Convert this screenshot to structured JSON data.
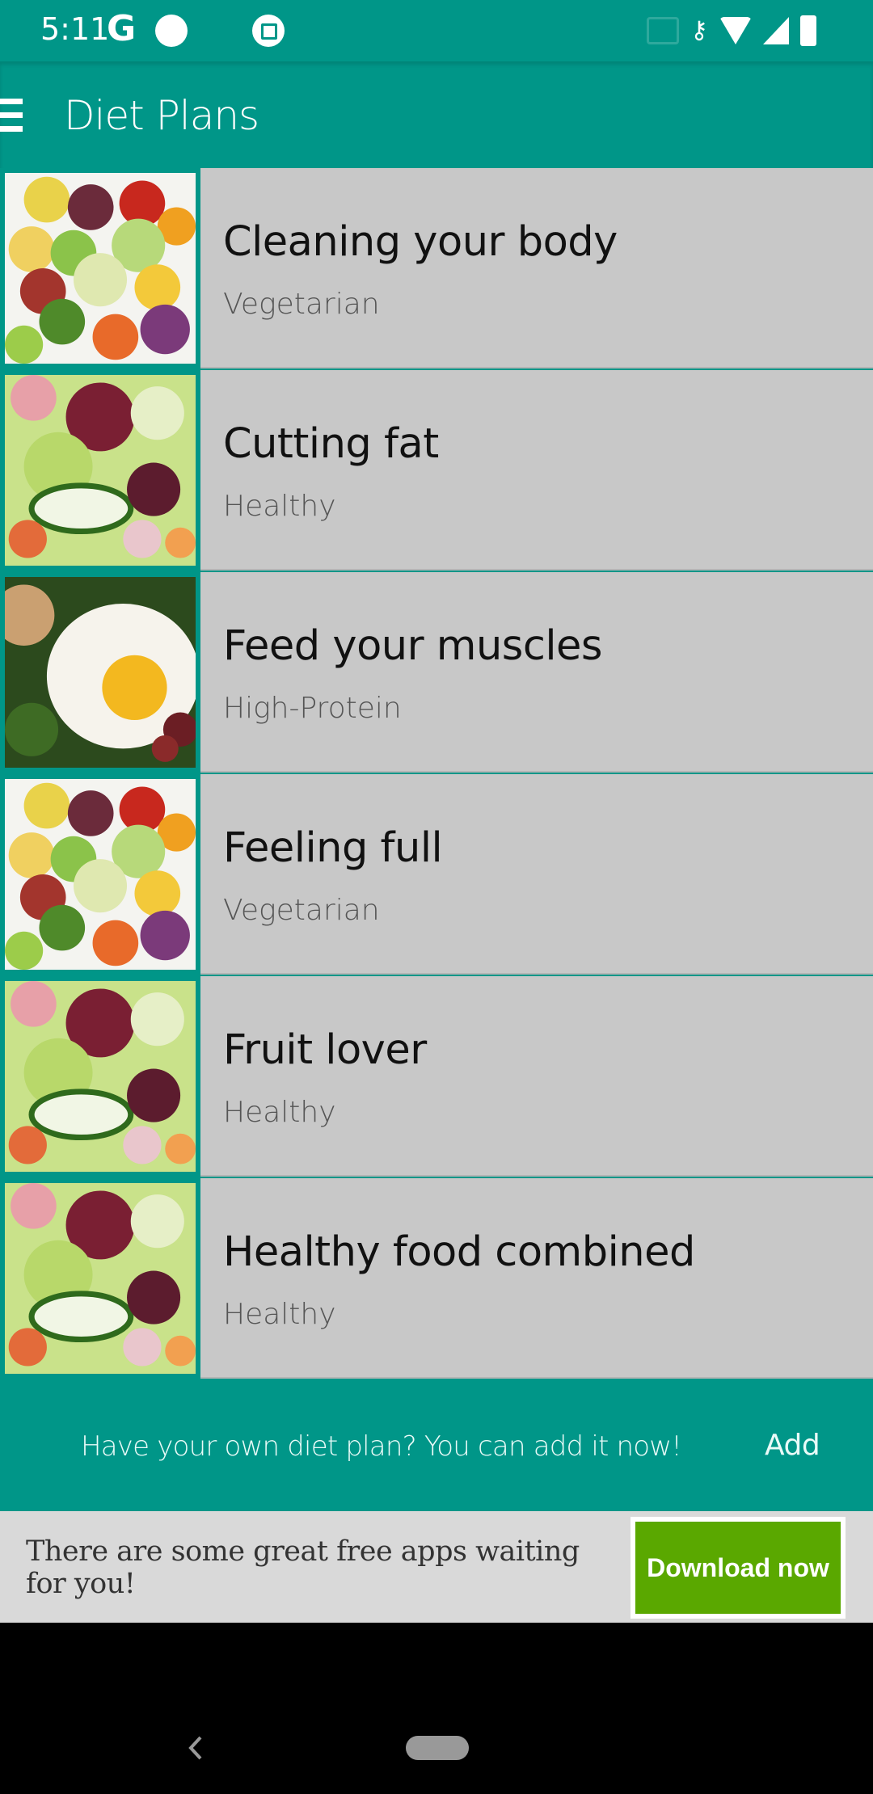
{
  "status_bar": {
    "time": "5:11",
    "notification_icons": [
      "google-icon",
      "circle-icon",
      "screenshot-icon"
    ],
    "system_icons": [
      "cast-icon",
      "vpn-key-icon",
      "wifi-icon",
      "signal-icon",
      "battery-charging-icon"
    ]
  },
  "app_bar": {
    "title": "Diet Plans",
    "menu_icon": "hamburger-menu-icon"
  },
  "diet_plans": [
    {
      "title": "Cleaning your body",
      "category": "Vegetarian",
      "image": "fruits-vegetables-image"
    },
    {
      "title": "Cutting fat",
      "category": "Healthy",
      "image": "salad-image"
    },
    {
      "title": "Feed your muscles",
      "category": "High-Protein",
      "image": "egg-image"
    },
    {
      "title": "Feeling full",
      "category": "Vegetarian",
      "image": "fruits-vegetables-image"
    },
    {
      "title": "Fruit lover",
      "category": "Healthy",
      "image": "salad-image"
    },
    {
      "title": "Healthy food combined",
      "category": "Healthy",
      "image": "salad-image"
    }
  ],
  "footer": {
    "message": "Have your own diet plan? You can add it now!",
    "add_label": "Add"
  },
  "ad_banner": {
    "text": "There are some great free apps waiting for you!",
    "button_label": "Download now",
    "button_color": "#5aa800"
  },
  "colors": {
    "primary": "#009688",
    "card_bg": "#c8c8c8"
  },
  "nav_bar": {
    "back_icon": "back-icon",
    "home_icon": "home-pill-icon"
  }
}
